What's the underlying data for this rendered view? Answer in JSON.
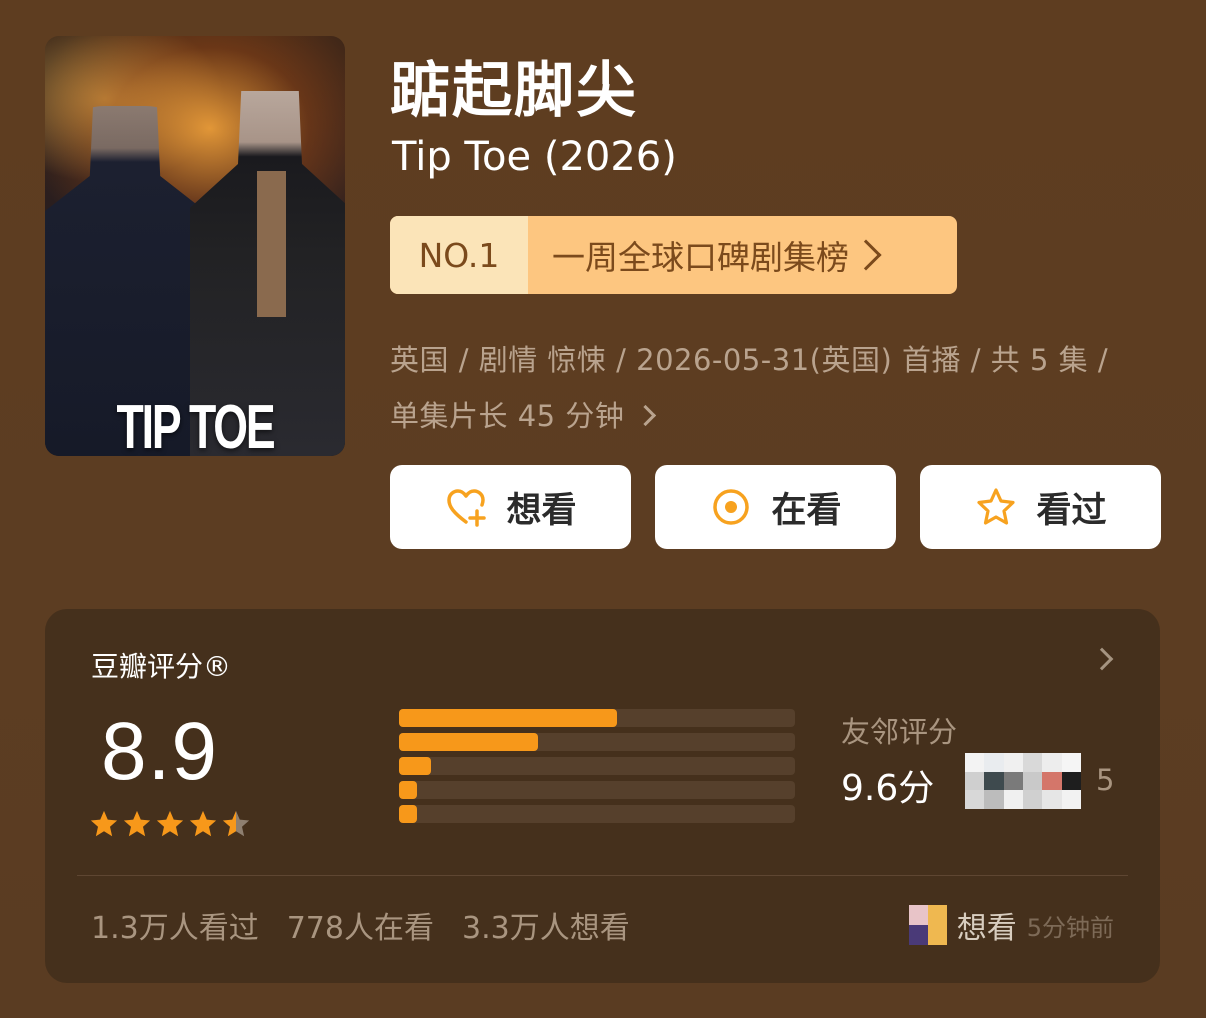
{
  "poster": {
    "title_text": "TIP TOE"
  },
  "title": {
    "cn": "踮起脚尖",
    "en": "Tip Toe (2026)"
  },
  "ranking": {
    "rank": "NO.1",
    "list_name": "一周全球口碑剧集榜"
  },
  "meta": {
    "line1": "英国 / 剧情 惊悚 / 2026-05-31(英国) 首播 / 共 5 集 /",
    "line2": "单集片长 45 分钟"
  },
  "actions": {
    "want_label": "想看",
    "watching_label": "在看",
    "watched_label": "看过"
  },
  "rating": {
    "panel_title": "豆瓣评分®",
    "score": "8.9",
    "stars": 4.5,
    "distribution": [
      {
        "stars": 5,
        "fraction": 0.55
      },
      {
        "stars": 4,
        "fraction": 0.35
      },
      {
        "stars": 3,
        "fraction": 0.08
      },
      {
        "stars": 2,
        "fraction": 0.04
      },
      {
        "stars": 1,
        "fraction": 0.04
      }
    ],
    "friends_label": "友邻评分",
    "friends_score": "9.6分",
    "friends_count": "5"
  },
  "stats": {
    "watched": "1.3万人看过",
    "watching": "778人在看",
    "want": "3.3万人想看"
  },
  "recent_activity": {
    "action": "想看",
    "time": "5分钟前"
  },
  "colors": {
    "background": "#5e3d20",
    "panel": "#45301c",
    "accent_orange": "#f7981a",
    "badge": "#fdc680",
    "badge_text": "#7b4a1c"
  }
}
